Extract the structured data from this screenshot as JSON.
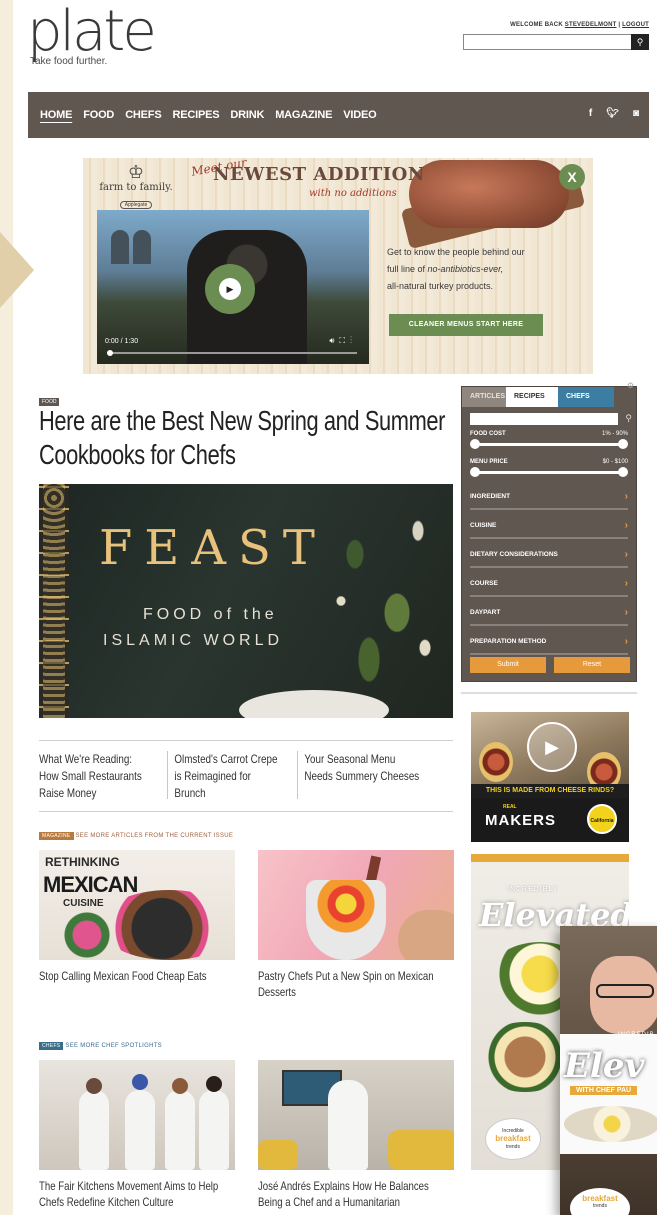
{
  "site": {
    "logo": "plate",
    "tagline": "Take food further.",
    "welcome_prefix": "WELCOME BACK",
    "username": "STEVEDELMONT",
    "logout": "LOGOUT",
    "search_placeholder": ""
  },
  "nav": {
    "items": [
      "HOME",
      "FOOD",
      "CHEFS",
      "RECIPES",
      "DRINK",
      "MAGAZINE",
      "VIDEO"
    ],
    "social": [
      "f",
      "t",
      "ig"
    ]
  },
  "ad_top": {
    "brand": "farm to family.",
    "brand_sub": "Applegate",
    "meet": "Meet our",
    "headline": "NEWEST ADDITION",
    "subhead": "with no additions",
    "close": "X",
    "video_time": "0:00 / 1:30",
    "copy_1": "Get to know the people behind our",
    "copy_2": "full line of ",
    "copy_em": "no-antibiotics-ever,",
    "copy_3": "all-natural turkey products.",
    "cta": "CLEANER MENUS START HERE"
  },
  "article": {
    "category": "FOOD",
    "title": "Here are the Best New Spring and Summer Cookbooks for Chefs",
    "hero_title": "FEAST",
    "hero_sub_1": "FOOD of the",
    "hero_sub_2": "ISLAMIC WORLD",
    "related": [
      "What We're Reading: How Small Restaurants Raise Money",
      "Olmsted's Carrot Crepe is Reimagined for Brunch",
      "Your Seasonal Menu Needs Summery Cheeses"
    ]
  },
  "magazine": {
    "tag": "MAGAZINE",
    "link": "SEE MORE ARTICLES FROM THE CURRENT ISSUE",
    "cards": [
      {
        "image_text_1": "RETHINKING",
        "image_text_2": "MEXICAN",
        "image_text_3": "CUISINE",
        "caption": "Stop Calling Mexican Food Cheap Eats"
      },
      {
        "caption": "Pastry Chefs Put a New Spin on Mexican Desserts"
      }
    ]
  },
  "chefs": {
    "tag": "CHEFS",
    "link": "SEE MORE CHEF SPOTLIGHTS",
    "cards": [
      {
        "caption": "The Fair Kitchens Movement Aims to Help Chefs Redefine Kitchen Culture"
      },
      {
        "caption": "José Andrés Explains How He Balances Being a Chef and a Humanitarian"
      }
    ]
  },
  "search_widget": {
    "tabs": [
      "ARTICLES",
      "RECIPES",
      "CHEFS"
    ],
    "active_tab": "RECIPES",
    "food_cost_label": "FOOD COST",
    "food_cost_range": "1% - 90%",
    "menu_price_label": "MENU PRICE",
    "menu_price_range": "$0 - $100",
    "filters": [
      "INGREDIENT",
      "CUISINE",
      "DIETARY CONSIDERATIONS",
      "COURSE",
      "DAYPART",
      "PREPARATION METHOD"
    ],
    "submit": "Submit",
    "reset": "Reset",
    "accent": "#e69a3b"
  },
  "ad_cheese": {
    "strip": "THIS IS MADE FROM CHEESE RINDS?",
    "real": "REAL",
    "makers": "MAKERS",
    "seal": "California"
  },
  "ad_elevated": {
    "incredibly": "INCREDIBLY",
    "elevated": "Elevated",
    "logo_top": "Incredible",
    "logo_main": "breakfast",
    "logo_bottom": "trends"
  },
  "ad_elevated_popup": {
    "incred": "INCREDIB",
    "elev": "Elev",
    "with_chef": "WITH CHEF PAU",
    "logo_main": "breakfast",
    "logo_bottom": "trends"
  }
}
